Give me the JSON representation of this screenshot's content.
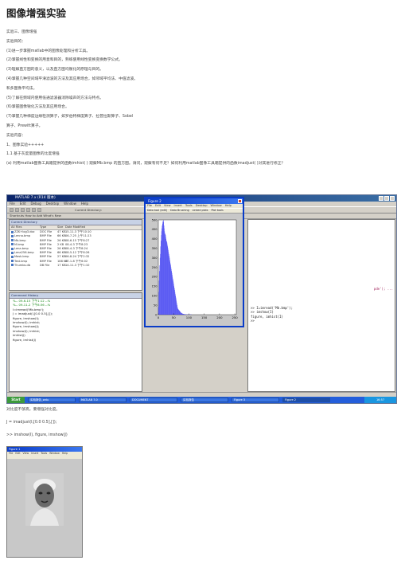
{
  "doc": {
    "title": "图像增强实验",
    "lines": [
      "实验三、图像增强",
      "实验目的：",
      "(1)进一步掌握matlab中的图像处理和分析工具。",
      "(2)掌握线性和变换的用意和目的，熟练使用线性变换变换数学公式。",
      "(3)理解直方图的意义，以及直方图均衡化的原理与目的。",
      "(4)掌握几种空间域平滑滤波的方法及其应用场合，如邻域平均法、中值滤波。",
      "和多图像平均法。",
      "(5)了解在频域内使用低通滤波器消除噪声的方法与特点。",
      "(6)掌握图像锐化方法及其应用场合。",
      "(7)掌握几种梯度边缘检测算子，如罗伯特梯度算子、拉普拉斯算子、Sobel",
      "算子、Prewitt算子。",
      "实验内容：",
      "1、图像实验+++++",
      "1.1 基于灰度量图像的比度增强",
      "(a) 利用matlab图像工具箱提供的函数imhist( ) 观察Mb.bmp 的直方图。请问，观察有何不足？如何利用matlab图像工具箱提供的函数imadjust( )对其进行修正？"
    ],
    "after_lines": [
      "对比度不够高，要增强对比度。",
      "J = imadjust(I,[0.0 0.5],[]);",
      ">> imshow(I), figure, imshow(J)"
    ]
  },
  "matlab": {
    "window_title": "MATLAB  7.x (R14 版本)",
    "menu": [
      "File",
      "Edit",
      "Debug",
      "Desktop",
      "Window",
      "Help"
    ],
    "current_dir_label": "Current Directory:",
    "current_dir_value": "C:\\MATLAB7\\work",
    "shortcuts": "Shortcuts  How to Add  What's New",
    "file_pane_title": "Current Directory",
    "file_headers": [
      "All Files",
      "Type",
      "Size",
      "Date Modified"
    ],
    "files": [
      [
        "ZZK+log3.doc",
        "DOC File",
        "47 KB",
        "15-11-3 下午10:10"
      ],
      [
        "Lenna.bmp",
        "BMP File",
        "66 KB",
        "06-7-25 上午11:23"
      ],
      [
        "Mb.bmp",
        "BMP File",
        "26 KB",
        "08-6-15 下午8:27"
      ],
      [
        "M.bmp",
        "BMP File",
        "2 KB",
        "08-4-3 下午8:23"
      ],
      [
        "Lena.bmp",
        "BMP File",
        "26 KB",
        "08-4-3 下午8:24"
      ],
      [
        "Lena256.bmp",
        "BMP File",
        "66 KB",
        "08-5-12 下午8:26"
      ],
      [
        "Mask.bmp",
        "BMP File",
        "27 KB",
        "06-8-24 下午2:32"
      ],
      [
        "Test.bmp",
        "BMP File",
        "188 KB",
        "07-1-8 下午6:02"
      ],
      [
        "Thumbs.db",
        "DB File",
        "17 KB",
        "14-11-3 下午1:10"
      ]
    ],
    "history_title": "Command History",
    "history": [
      "%-- 09-6-15  下午1:12 --%",
      "%-- 09-11-2  下午8:36 --%",
      "I=imread('Mb.bmp');",
      "J = imadjust(I,[0.0 0.5],[]);",
      "figure, imshow(I);",
      "imshow(I); imhist;",
      "figure, imshow(J);",
      "imshow(I); imhist;",
      "imhist(J)",
      "figure, imhist(J)"
    ],
    "command_lines": [
      ">> I=imread('Mb.bmp');",
      ">> imshow(I)",
      "figure, imhist(I)",
      ">>"
    ],
    "status": "Start",
    "taskbar": [
      "实验报告_wdu",
      "MATLAB 7.0",
      "DOCUMENT",
      "实验报告",
      "Figure 3",
      "Figure 2"
    ],
    "tray_time": "16:57",
    "figure_title": "Figure 2",
    "figure_menu": [
      "File",
      "Edit",
      "View",
      "Insert",
      "Tools",
      "Desktop",
      "Window",
      "Help"
    ],
    "figure_tool": [
      "Data tool (edit)",
      "Data Brushing",
      "Linked plots",
      "Plot tools"
    ],
    "image_title": "Figure 1",
    "image_menu": [
      "File",
      "Edit",
      "View",
      "Insert",
      "Tools",
      "Window",
      "Help"
    ]
  },
  "chart_data": {
    "type": "bar",
    "title": "",
    "xlabel": "",
    "ylabel": "",
    "xlim": [
      0,
      255
    ],
    "ylim": [
      0,
      500
    ],
    "xticks": [
      0,
      50,
      100,
      150,
      200,
      250
    ],
    "yticks": [
      0,
      50,
      100,
      150,
      200,
      250,
      300,
      350,
      400,
      450,
      500
    ],
    "bar_color": "#3a3af0",
    "x_start": 0,
    "x_step": 1,
    "values": [
      40,
      120,
      180,
      230,
      260,
      300,
      320,
      360,
      390,
      420,
      440,
      455,
      470,
      480,
      490,
      495,
      500,
      490,
      470,
      455,
      440,
      430,
      425,
      420,
      410,
      400,
      390,
      385,
      380,
      370,
      360,
      350,
      340,
      330,
      320,
      310,
      300,
      290,
      280,
      270,
      260,
      250,
      240,
      230,
      220,
      210,
      200,
      190,
      180,
      170,
      160,
      150,
      140,
      130,
      120,
      110,
      100,
      90,
      80,
      70,
      60,
      50,
      40,
      35,
      30,
      28,
      26,
      24,
      22,
      20,
      18,
      16,
      14,
      12,
      10,
      9,
      8,
      7,
      6,
      5,
      5,
      4,
      4,
      3,
      3,
      3,
      2,
      2,
      2,
      2,
      2,
      1,
      1,
      1,
      1,
      1,
      1,
      1,
      1,
      1,
      1,
      1,
      1,
      1,
      1,
      1,
      1,
      1,
      1,
      0,
      0,
      0,
      0,
      0,
      0,
      0,
      0,
      0,
      0,
      0,
      0,
      0,
      0,
      0,
      0,
      0,
      0,
      0,
      0,
      0,
      0,
      0,
      0,
      0,
      0,
      0,
      0,
      0,
      0,
      0,
      0,
      0,
      0,
      0,
      0,
      0,
      0,
      0,
      0,
      0
    ]
  }
}
